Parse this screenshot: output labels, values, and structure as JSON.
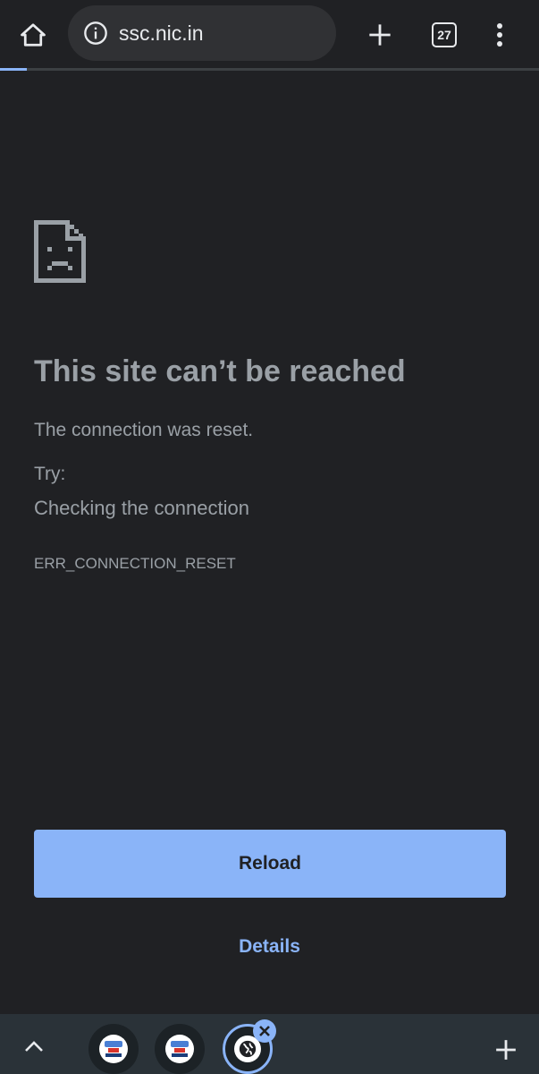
{
  "toolbar": {
    "url": "ssc.nic.in",
    "tab_count": "27",
    "icons": [
      "home-icon",
      "info-icon",
      "plus-icon",
      "tab-switcher-icon",
      "more-vert-icon"
    ]
  },
  "progress": {
    "fraction": 0.05,
    "color": "#8ab4f8"
  },
  "error": {
    "icon": "sad-page-icon",
    "heading": "This site can’t be reached",
    "message": "The connection was reset.",
    "try_label": "Try:",
    "suggestion": "Checking the connection",
    "code": "ERR_CONNECTION_RESET"
  },
  "actions": {
    "reload_label": "Reload",
    "details_label": "Details"
  },
  "colors": {
    "background": "#202124",
    "accent": "#8ab4f8",
    "text": "#9aa0a6",
    "bottom_bar": "#2a3238"
  },
  "tab_strip": {
    "icons": [
      "chevron-up-icon",
      "tab-favicon",
      "tab-favicon",
      "globe-icon",
      "close-icon",
      "plus-icon"
    ]
  }
}
